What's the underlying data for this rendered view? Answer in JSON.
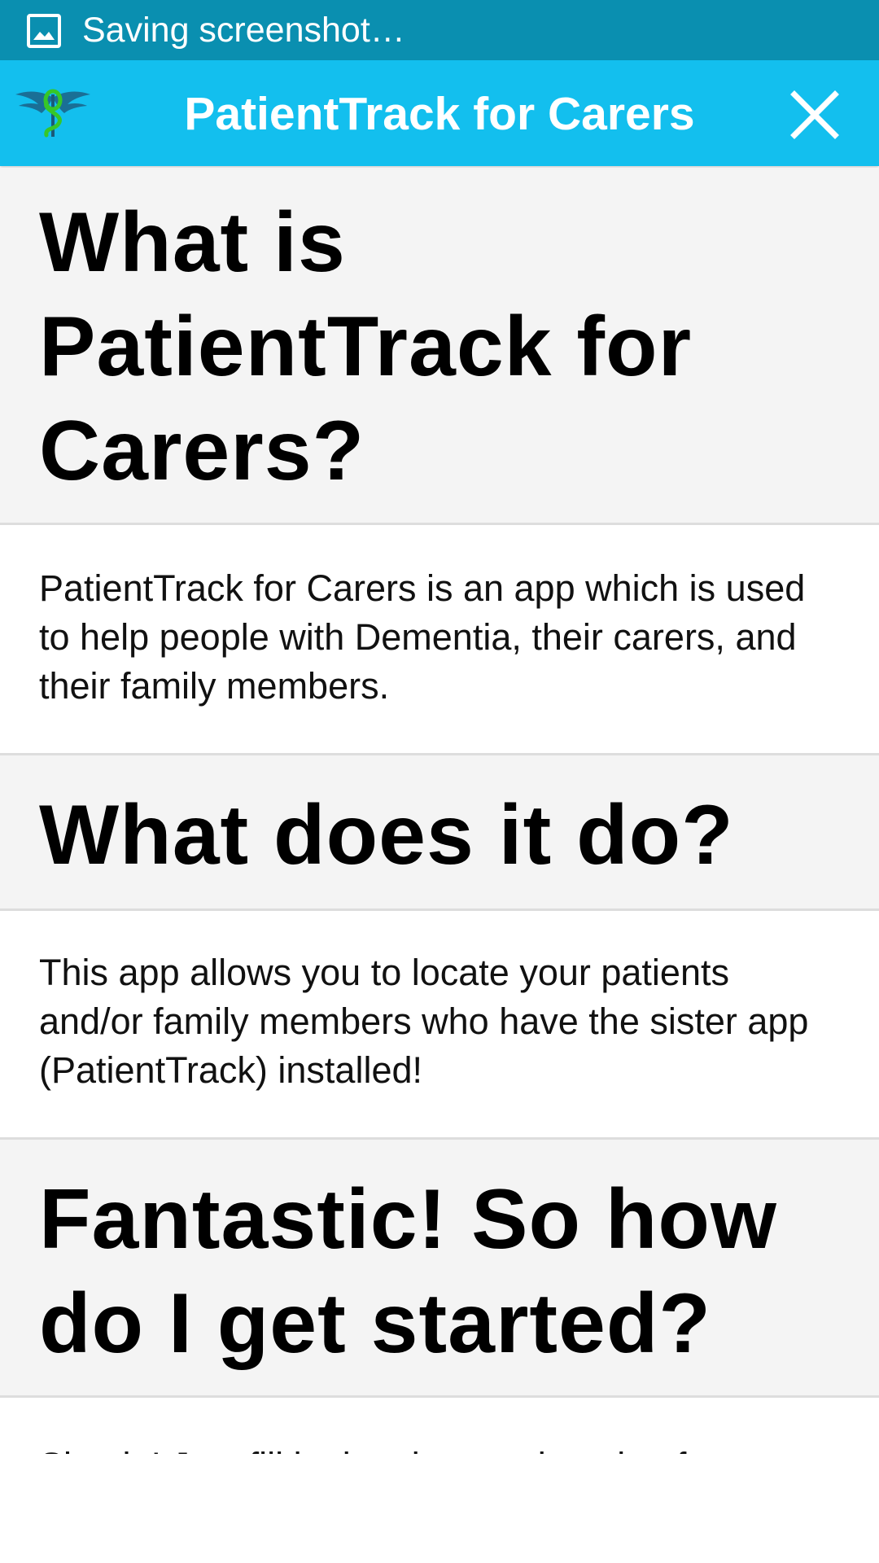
{
  "status_bar": {
    "text": "Saving screenshot…",
    "background": "#0a8fb0",
    "icon": "image-icon"
  },
  "app_bar": {
    "title": "PatientTrack for Carers",
    "background": "#13bfee",
    "logo_icon": "caduceus-logo-icon",
    "close_icon": "close-icon"
  },
  "content": {
    "sections": [
      {
        "type": "heading",
        "text": "What is PatientTrack for Carers?"
      },
      {
        "type": "paragraph",
        "text": "PatientTrack for Carers is an app which is used to help people with Dementia, their carers, and their family members."
      },
      {
        "type": "heading",
        "text": "What does it do?"
      },
      {
        "type": "paragraph",
        "text": "This app allows you to locate your patients and/or family members who have the sister app (PatientTrack) installed!"
      },
      {
        "type": "heading",
        "text": "Fantastic! So how do I get started?"
      },
      {
        "type": "paragraph",
        "text": "Simple! Just fill in the short registration form"
      }
    ]
  }
}
